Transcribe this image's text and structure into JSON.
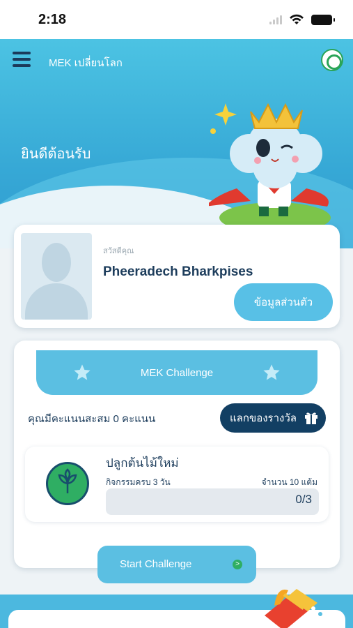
{
  "status_bar": {
    "time": "2:18"
  },
  "header": {
    "app_title": "MEK เปลี่ยนโลก",
    "welcome": "ยินดีต้อนรับ"
  },
  "profile": {
    "greeting": "สวัสดีคุณ",
    "name": "Pheeradech Bharkpises",
    "info_button": "ข้อมูลส่วนตัว"
  },
  "challenge": {
    "banner_title": "MEK Challenge",
    "points_text": "คุณมีคะแนนสะสม 0 คะแนน",
    "redeem_button": "แลกของรางวัล",
    "task": {
      "title": "ปลูกต้นไม้ใหม่",
      "description": "กิจกรรมครบ 3 วัน",
      "points": "จำนวน 10 แต้ม",
      "progress_text": "0/3",
      "progress_value": 0
    },
    "start_button": "Start Challenge",
    "start_arrow": ">"
  },
  "colors": {
    "accent": "#58c0e6",
    "dark": "#123f63",
    "green": "#2fae63"
  }
}
